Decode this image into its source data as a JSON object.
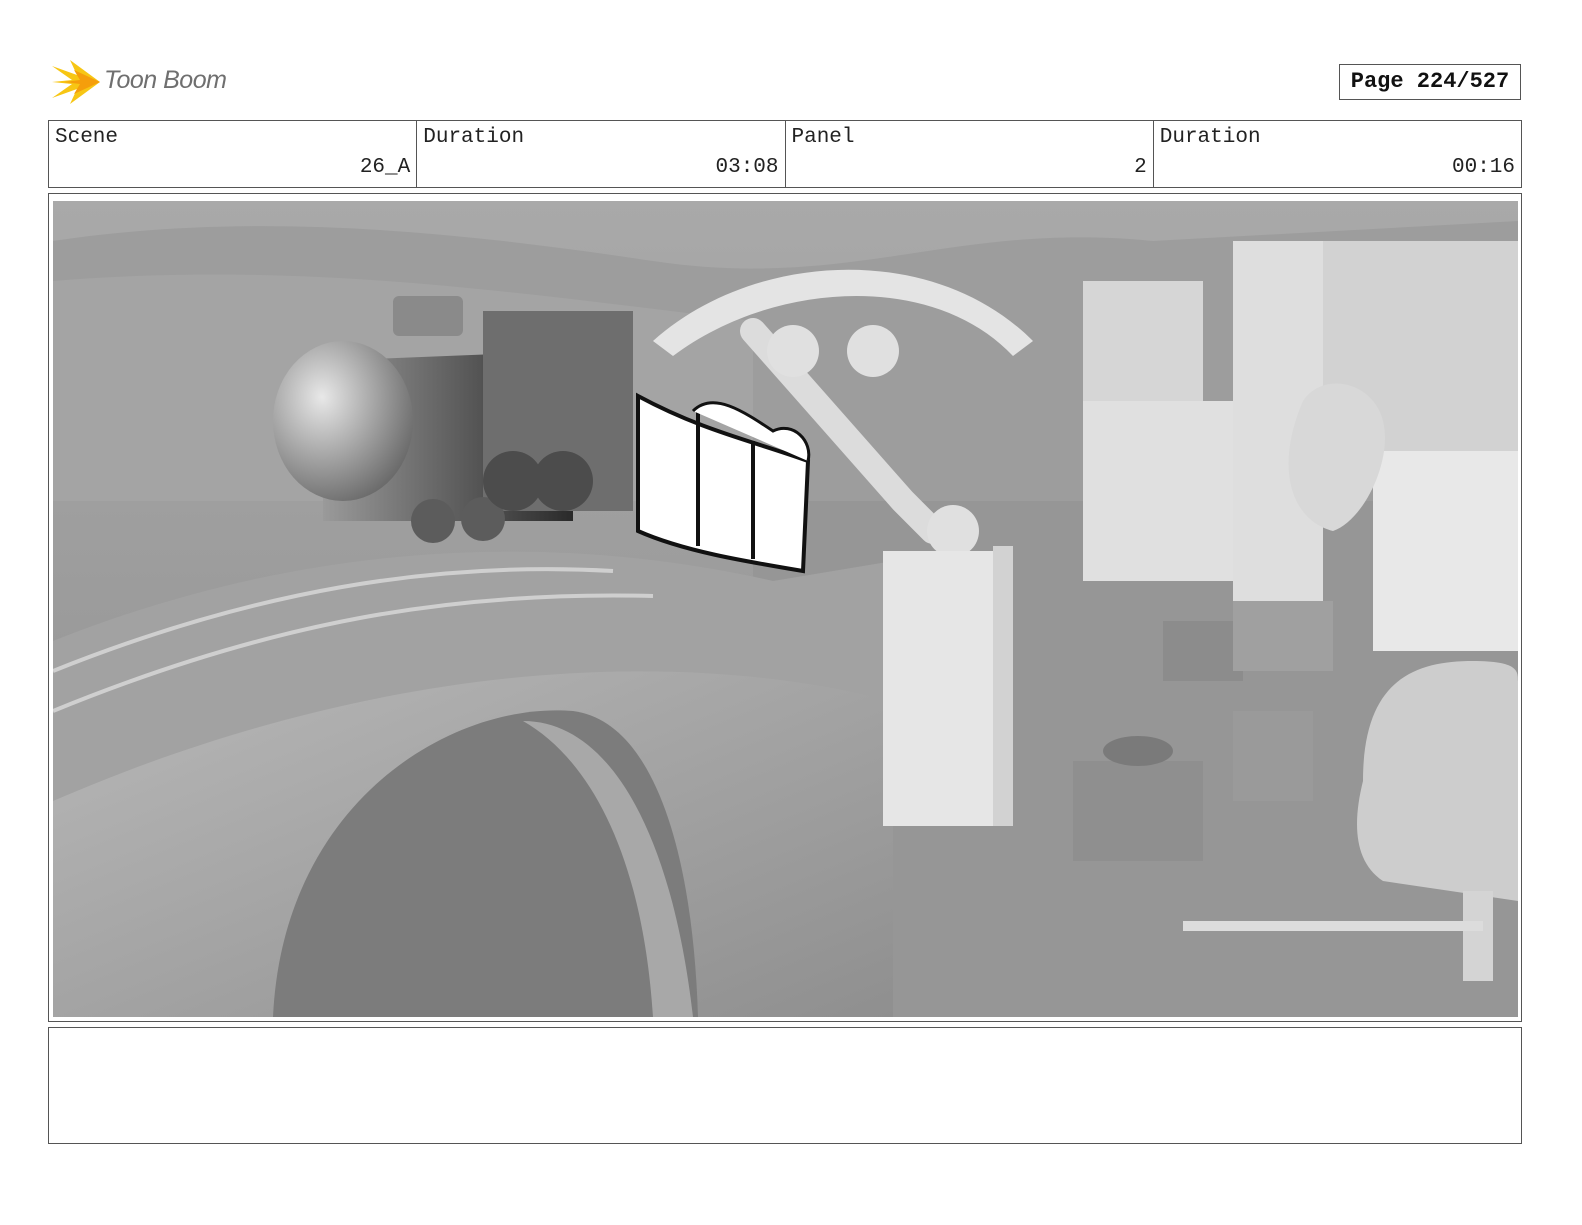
{
  "header": {
    "brand_name": "Toon Boom",
    "page_label": "Page 224/527"
  },
  "info": {
    "scene": {
      "label": "Scene",
      "value": "26_A"
    },
    "scene_duration": {
      "label": "Duration",
      "value": "03:08"
    },
    "panel": {
      "label": "Panel",
      "value": "2"
    },
    "panel_duration": {
      "label": "Duration",
      "value": "00:16"
    }
  },
  "panel_image": {
    "icon": "storyboard-3d-render-image"
  },
  "notes": {
    "text": ""
  },
  "colors": {
    "border": "#555555",
    "logo_accent": "#f5c518"
  }
}
